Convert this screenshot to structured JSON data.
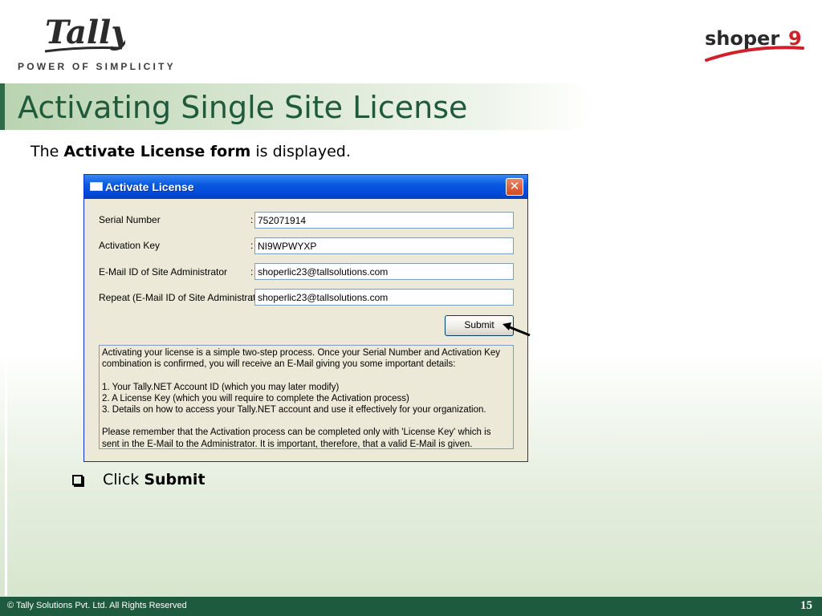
{
  "branding": {
    "tally_logo_text": "Tally",
    "tally_tagline": "POWER OF SIMPLICITY",
    "shoper_logo_text": "shoper",
    "shoper_logo_number": "9"
  },
  "slide": {
    "title": "Activating Single Site License",
    "intro_prefix": "The ",
    "intro_bold": "Activate License form",
    "intro_suffix": " is displayed.",
    "bullet_prefix": "Click ",
    "bullet_bold": "Submit"
  },
  "dialog": {
    "title": "Activate License",
    "close_glyph": "✕",
    "fields": [
      {
        "label": "Serial Number",
        "value": "752071914"
      },
      {
        "label": "Activation Key",
        "value": "NI9WPWYXP"
      },
      {
        "label": "E-Mail ID of Site Administrator",
        "value": "shoperlic23@tallsolutions.com"
      },
      {
        "label": "Repeat (E-Mail ID of Site Administrat",
        "value": "shoperlic23@tallsolutions.com"
      }
    ],
    "colon": ":",
    "submit_label": "Submit",
    "info_text": "Activating your license is a simple two-step process. Once your Serial Number and Activation Key combination is confirmed, you will receive an E-Mail giving you some important details:\n\n1.  Your Tally.NET Account ID (which you may later modify)\n2.  A License Key (which you will require to complete the Activation process)\n3.  Details on how to access your Tally.NET account and use it effectively for your organization.\n\nPlease remember that the Activation process can be completed only with 'License Key' which is sent in the E-Mail to the Administrator. It is important, therefore, that a valid E-Mail is given."
  },
  "footer": {
    "copyright": "© Tally Solutions Pvt. Ltd. All Rights Reserved",
    "page_number": "15"
  },
  "colors": {
    "title_green": "#1f5a3a",
    "footer_green": "#1e5a3e",
    "xp_blue": "#0a5ae0",
    "shoper_red": "#d2202b"
  }
}
